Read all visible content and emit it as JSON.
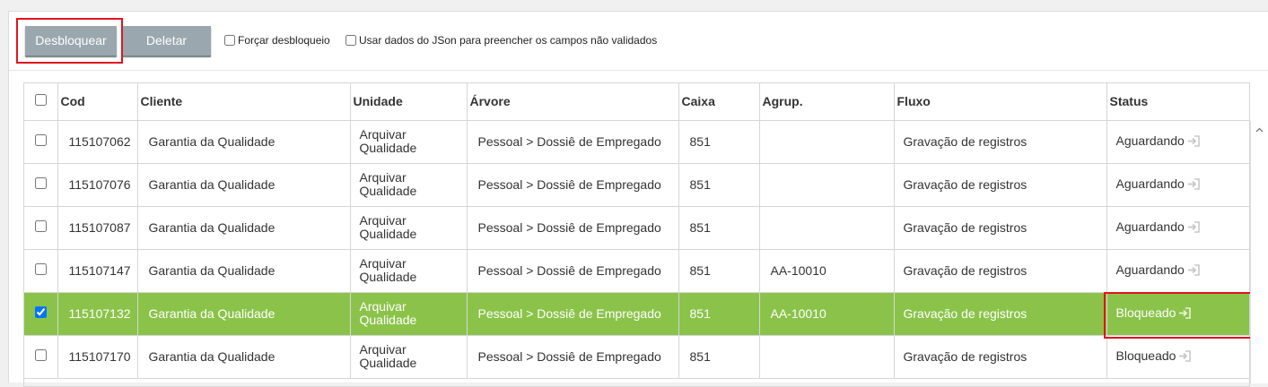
{
  "toolbar": {
    "unlock_label": "Desbloquear",
    "delete_label": "Deletar",
    "force_unlock_label": "Forçar desbloqueio",
    "use_json_label": "Usar dados do JSon para preencher os campos não validados"
  },
  "table": {
    "headers": {
      "cod": "Cod",
      "cliente": "Cliente",
      "unidade": "Unidade",
      "arvore": "Árvore",
      "caixa": "Caixa",
      "agrup": "Agrup.",
      "fluxo": "Fluxo",
      "status": "Status"
    },
    "rows": [
      {
        "cod": "115107062",
        "cliente": "Garantia da Qualidade",
        "unidade_1": "Arquivar",
        "unidade_2": "Qualidade",
        "arvore": "Pessoal > Dossiê de Empregado",
        "caixa": "851",
        "agrup": "",
        "fluxo": "Gravação de registros",
        "status": "Aguardando",
        "selected": false
      },
      {
        "cod": "115107076",
        "cliente": "Garantia da Qualidade",
        "unidade_1": "Arquivar",
        "unidade_2": "Qualidade",
        "arvore": "Pessoal > Dossiê de Empregado",
        "caixa": "851",
        "agrup": "",
        "fluxo": "Gravação de registros",
        "status": "Aguardando",
        "selected": false
      },
      {
        "cod": "115107087",
        "cliente": "Garantia da Qualidade",
        "unidade_1": "Arquivar",
        "unidade_2": "Qualidade",
        "arvore": "Pessoal > Dossiê de Empregado",
        "caixa": "851",
        "agrup": "",
        "fluxo": "Gravação de registros",
        "status": "Aguardando",
        "selected": false
      },
      {
        "cod": "115107147",
        "cliente": "Garantia da Qualidade",
        "unidade_1": "Arquivar",
        "unidade_2": "Qualidade",
        "arvore": "Pessoal > Dossiê de Empregado",
        "caixa": "851",
        "agrup": "AA-10010",
        "fluxo": "Gravação de registros",
        "status": "Aguardando",
        "selected": false
      },
      {
        "cod": "115107132",
        "cliente": "Garantia da Qualidade",
        "unidade_1": "Arquivar",
        "unidade_2": "Qualidade",
        "arvore": "Pessoal > Dossiê de Empregado",
        "caixa": "851",
        "agrup": "AA-10010",
        "fluxo": "Gravação de registros",
        "status": "Bloqueado",
        "selected": true
      },
      {
        "cod": "115107170",
        "cliente": "Garantia da Qualidade",
        "unidade_1": "Arquivar",
        "unidade_2": "Qualidade",
        "arvore": "Pessoal > Dossiê de Empregado",
        "caixa": "851",
        "agrup": "",
        "fluxo": "Gravação de registros",
        "status": "Bloqueado",
        "selected": false
      }
    ]
  },
  "colors": {
    "selected_row": "#8bc34a",
    "button": "#9aa7ae",
    "highlight": "#e0141e"
  },
  "icons": {
    "status_action": "sign-in-icon",
    "scroll_up": "chevron-up-icon"
  }
}
